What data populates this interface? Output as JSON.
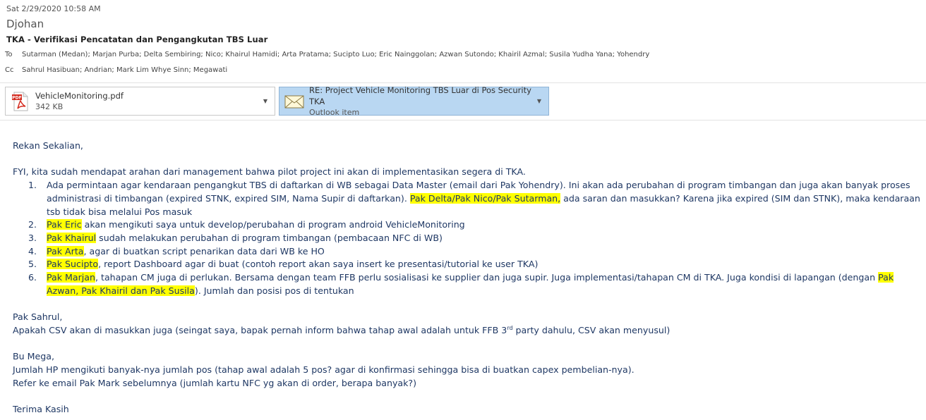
{
  "header": {
    "date": "Sat 2/29/2020 10:58 AM",
    "from": "Djohan",
    "subject": "TKA - Verifikasi Pencatatan dan Pengangkutan TBS Luar",
    "to_label": "To",
    "to": "Sutarman (Medan); Marjan Purba; Delta Sembiring; Nico; Khairul Hamidi; Arta Pratama; Sucipto Luo; Eric Nainggolan; Azwan Sutondo; Khairil Azmal; Susila Yudha Yana; Yohendry",
    "cc_label": "Cc",
    "cc": "Sahrul Hasibuan; Andrian; Mark Lim Whye Sinn; Megawati"
  },
  "attachments": [
    {
      "name": "VehicleMonitoring.pdf",
      "sub": "342 KB",
      "icon": "pdf-icon"
    },
    {
      "name": "RE: Project Vehicle Monitoring TBS Luar di Pos Security TKA",
      "sub": "Outlook item",
      "icon": "envelope-icon"
    }
  ],
  "body": {
    "greeting": "Rekan Sekalian,",
    "intro": "FYI, kita sudah mendapat arahan dari management bahwa pilot project ini akan di implementasikan segera di TKA.",
    "items": [
      {
        "num": "1.",
        "a": "Ada permintaan agar kendaraan pengangkut TBS di daftarkan di WB sebagai Data Master (email dari Pak Yohendry). Ini akan ada perubahan di program timbangan dan juga akan banyak proses administrasi di timbangan (expired STNK, expired SIM, Nama Supir di daftarkan). ",
        "hl": "Pak Delta/Pak Nico/Pak Sutarman,",
        "b": " ada saran dan masukkan? Karena jika expired (SIM dan STNK), maka kendaraan tsb tidak bisa melalui Pos masuk"
      },
      {
        "num": "2.",
        "hl": "Pak Eric",
        "b": " akan mengikuti saya untuk develop/perubahan di program android VehicleMonitoring"
      },
      {
        "num": "3.",
        "hl": "Pak Khairul",
        "b": " sudah melakukan perubahan di program timbangan (pembacaan NFC di WB)"
      },
      {
        "num": "4.",
        "hl": "Pak Arta",
        "b": ", agar di buatkan script penarikan data dari WB ke HO"
      },
      {
        "num": "5.",
        "hl": "Pak Sucipto",
        "b": ", report Dashboard agar di buat (contoh report akan saya insert ke presentasi/tutorial ke user TKA)"
      },
      {
        "num": "6.",
        "hl": "Pak Marjan",
        "b": ", tahapan CM juga di perlukan. Bersama dengan team FFB perlu sosialisasi ke supplier dan juga supir. Juga implementasi/tahapan CM di TKA. Juga kondisi di lapangan (dengan ",
        "hl2": "Pak Azwan, Pak Khairil dan Pak Susila",
        "c": "). Jumlah dan posisi pos di tentukan"
      }
    ],
    "sahrul_greet": "Pak Sahrul,",
    "sahrul_text_a": "Apakah CSV akan di masukkan juga (seingat saya, bapak pernah inform bahwa tahap awal adalah untuk FFB 3",
    "sahrul_sup": "rd",
    "sahrul_text_b": " party dahulu, CSV akan menyusul)",
    "mega_greet": "Bu Mega,",
    "mega_line1": "Jumlah HP mengikuti banyak-nya jumlah pos (tahap awal adalah 5 pos? agar di konfirmasi sehingga bisa di buatkan capex pembelian-nya).",
    "mega_line2": "Refer ke email Pak Mark sebelumnya (jumlah kartu NFC yg akan di order, berapa banyak?)",
    "closing": "Terima Kasih"
  }
}
